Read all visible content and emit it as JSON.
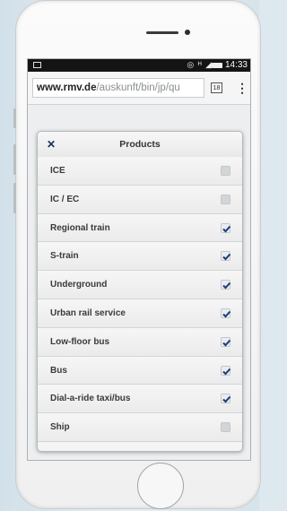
{
  "browser": {
    "url_domain": "www.rmv.de",
    "url_path": "/auskunft/bin/jp/qu",
    "tabs_count": "18",
    "menu_label": "⋮"
  },
  "statusbar": {
    "time": "14:33",
    "signal_icons": "◎ ᴴ ◢"
  },
  "dialog": {
    "title": "Products",
    "close_label": "✕",
    "items": [
      {
        "label": "ICE",
        "checked": false
      },
      {
        "label": "IC / EC",
        "checked": false
      },
      {
        "label": "Regional train",
        "checked": true
      },
      {
        "label": "S-train",
        "checked": true
      },
      {
        "label": "Underground",
        "checked": true
      },
      {
        "label": "Urban rail service",
        "checked": true
      },
      {
        "label": "Low-floor bus",
        "checked": true
      },
      {
        "label": "Bus",
        "checked": true
      },
      {
        "label": "Dial-a-ride taxi/bus",
        "checked": true
      },
      {
        "label": "Ship",
        "checked": false
      }
    ]
  },
  "colors": {
    "checkmark": "#1f3a78",
    "close": "#1c2c5c"
  }
}
